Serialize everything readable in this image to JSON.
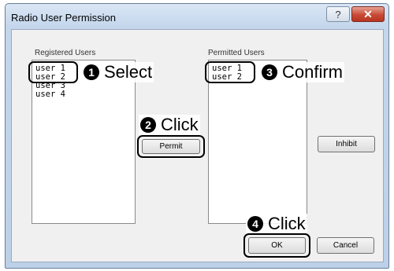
{
  "window": {
    "title": "Radio User Permission",
    "help_glyph": "?",
    "close_glyph": "✕"
  },
  "registered": {
    "label": "Registered Users",
    "items": [
      "user 1",
      "user 2",
      "user 3",
      "user 4"
    ]
  },
  "permitted": {
    "label": "Permitted Users",
    "items": [
      "user 1",
      "user 2"
    ]
  },
  "buttons": {
    "permit": "Permit",
    "inhibit": "Inhibit",
    "ok": "OK",
    "cancel": "Cancel"
  },
  "annotations": {
    "step1": {
      "num": "1",
      "text": "Select"
    },
    "step2": {
      "num": "2",
      "text": "Click"
    },
    "step3": {
      "num": "3",
      "text": "Confirm"
    },
    "step4": {
      "num": "4",
      "text": "Click"
    }
  },
  "colors": {
    "title_bar": "#c4d6ec",
    "close_button": "#c84a35",
    "client_bg": "#f0f0f0"
  }
}
